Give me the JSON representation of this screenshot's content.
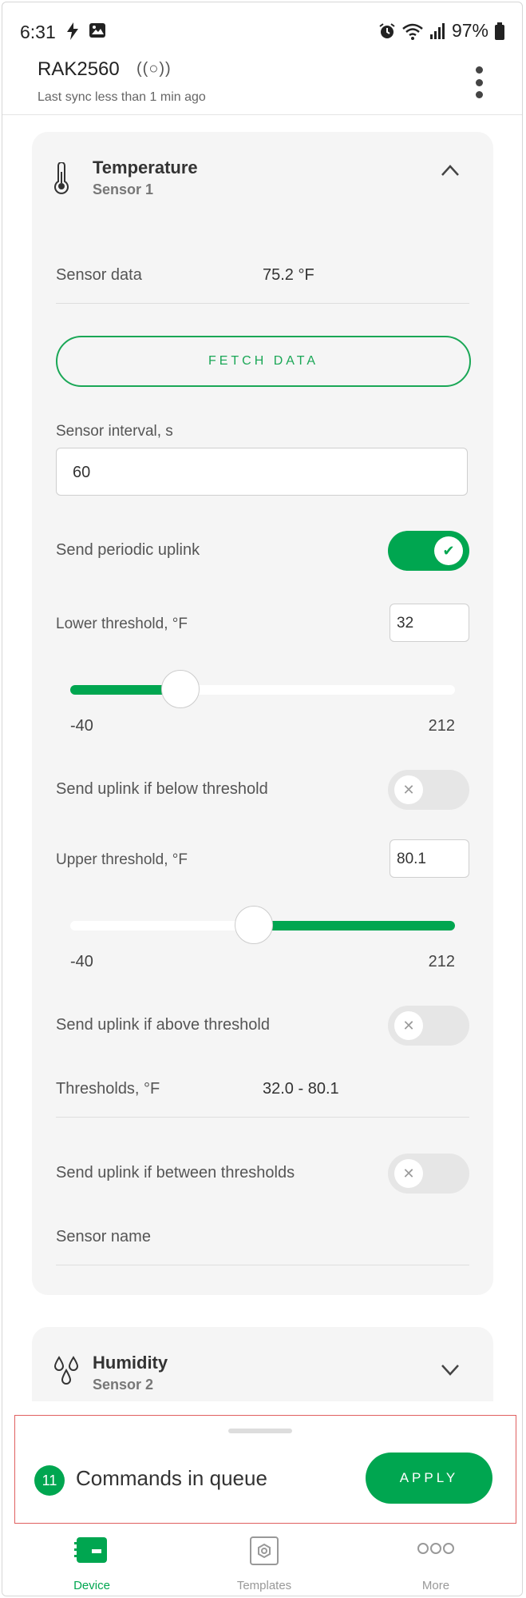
{
  "status_bar": {
    "time": "6:31",
    "battery": "97%",
    "icons": [
      "flash-icon",
      "image-icon",
      "alarm-icon",
      "wifi-icon",
      "signal-icon",
      "battery-icon"
    ]
  },
  "header": {
    "device_name": "RAK2560",
    "sync_text": "Last sync less than 1 min ago"
  },
  "temperature_card": {
    "title": "Temperature",
    "subtitle": "Sensor 1",
    "sensor_data_label": "Sensor data",
    "sensor_data_value": "75.2 °F",
    "fetch_button": "FETCH DATA",
    "interval_label": "Sensor interval, s",
    "interval_value": "60",
    "periodic_uplink_label": "Send periodic uplink",
    "periodic_uplink_on": true,
    "lower_threshold_label": "Lower threshold, °F",
    "lower_threshold_value": "32",
    "lower_slider": {
      "min": "-40",
      "max": "212",
      "value": 32,
      "fill": "left"
    },
    "below_label": "Send uplink if below threshold",
    "below_on": false,
    "upper_threshold_label": "Upper threshold, °F",
    "upper_threshold_value": "80.1",
    "upper_slider": {
      "min": "-40",
      "max": "212",
      "value": 80.1,
      "fill": "right"
    },
    "above_label": "Send uplink if above threshold",
    "above_on": false,
    "thresholds_label": "Thresholds, °F",
    "thresholds_value": "32.0 - 80.1",
    "between_label": "Send uplink if between thresholds",
    "between_on": false,
    "sensor_name_label": "Sensor name"
  },
  "humidity_card": {
    "title": "Humidity",
    "subtitle": "Sensor 2"
  },
  "queue": {
    "count": "11",
    "text": "Commands in queue",
    "apply": "APPLY"
  },
  "nav": {
    "items": [
      {
        "label": "Device",
        "active": true
      },
      {
        "label": "Templates",
        "active": false
      },
      {
        "label": "More",
        "active": false
      }
    ]
  },
  "colors": {
    "accent": "#00a650",
    "card_bg": "#f5f5f5",
    "highlight_border": "#e06060"
  }
}
